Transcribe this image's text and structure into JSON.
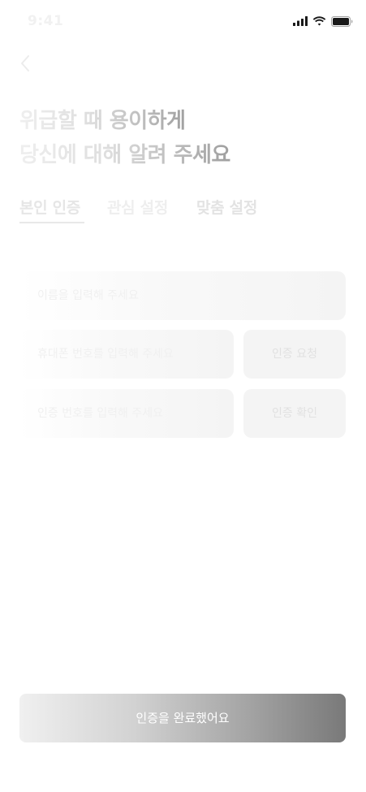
{
  "status_bar": {
    "time": "9:41"
  },
  "header": {
    "title_line1": "위급할 때 용이하게",
    "title_line2": "당신에 대해 알려 주세요"
  },
  "tabs": [
    {
      "label": "본인 인증",
      "active": true
    },
    {
      "label": "관심 설정",
      "active": false
    },
    {
      "label": "맞춤 설정",
      "active": false
    }
  ],
  "form": {
    "name_placeholder": "이름을 입력해 주세요",
    "phone_placeholder": "휴대폰 번호를 입력해 주세요",
    "code_placeholder": "인증 번호를 입력해 주세요",
    "request_label": "인증 요청",
    "confirm_label": "인증 확인"
  },
  "footer": {
    "complete_label": "인증을 완료했어요"
  },
  "icons": {
    "back": "chevron-left-icon",
    "signal": "signal-icon",
    "wifi": "wifi-icon",
    "battery": "battery-icon"
  },
  "colors": {
    "button_gradient_end": "#797979",
    "field_background": "#f4f4f4",
    "text_light": "#e6e6e6"
  }
}
